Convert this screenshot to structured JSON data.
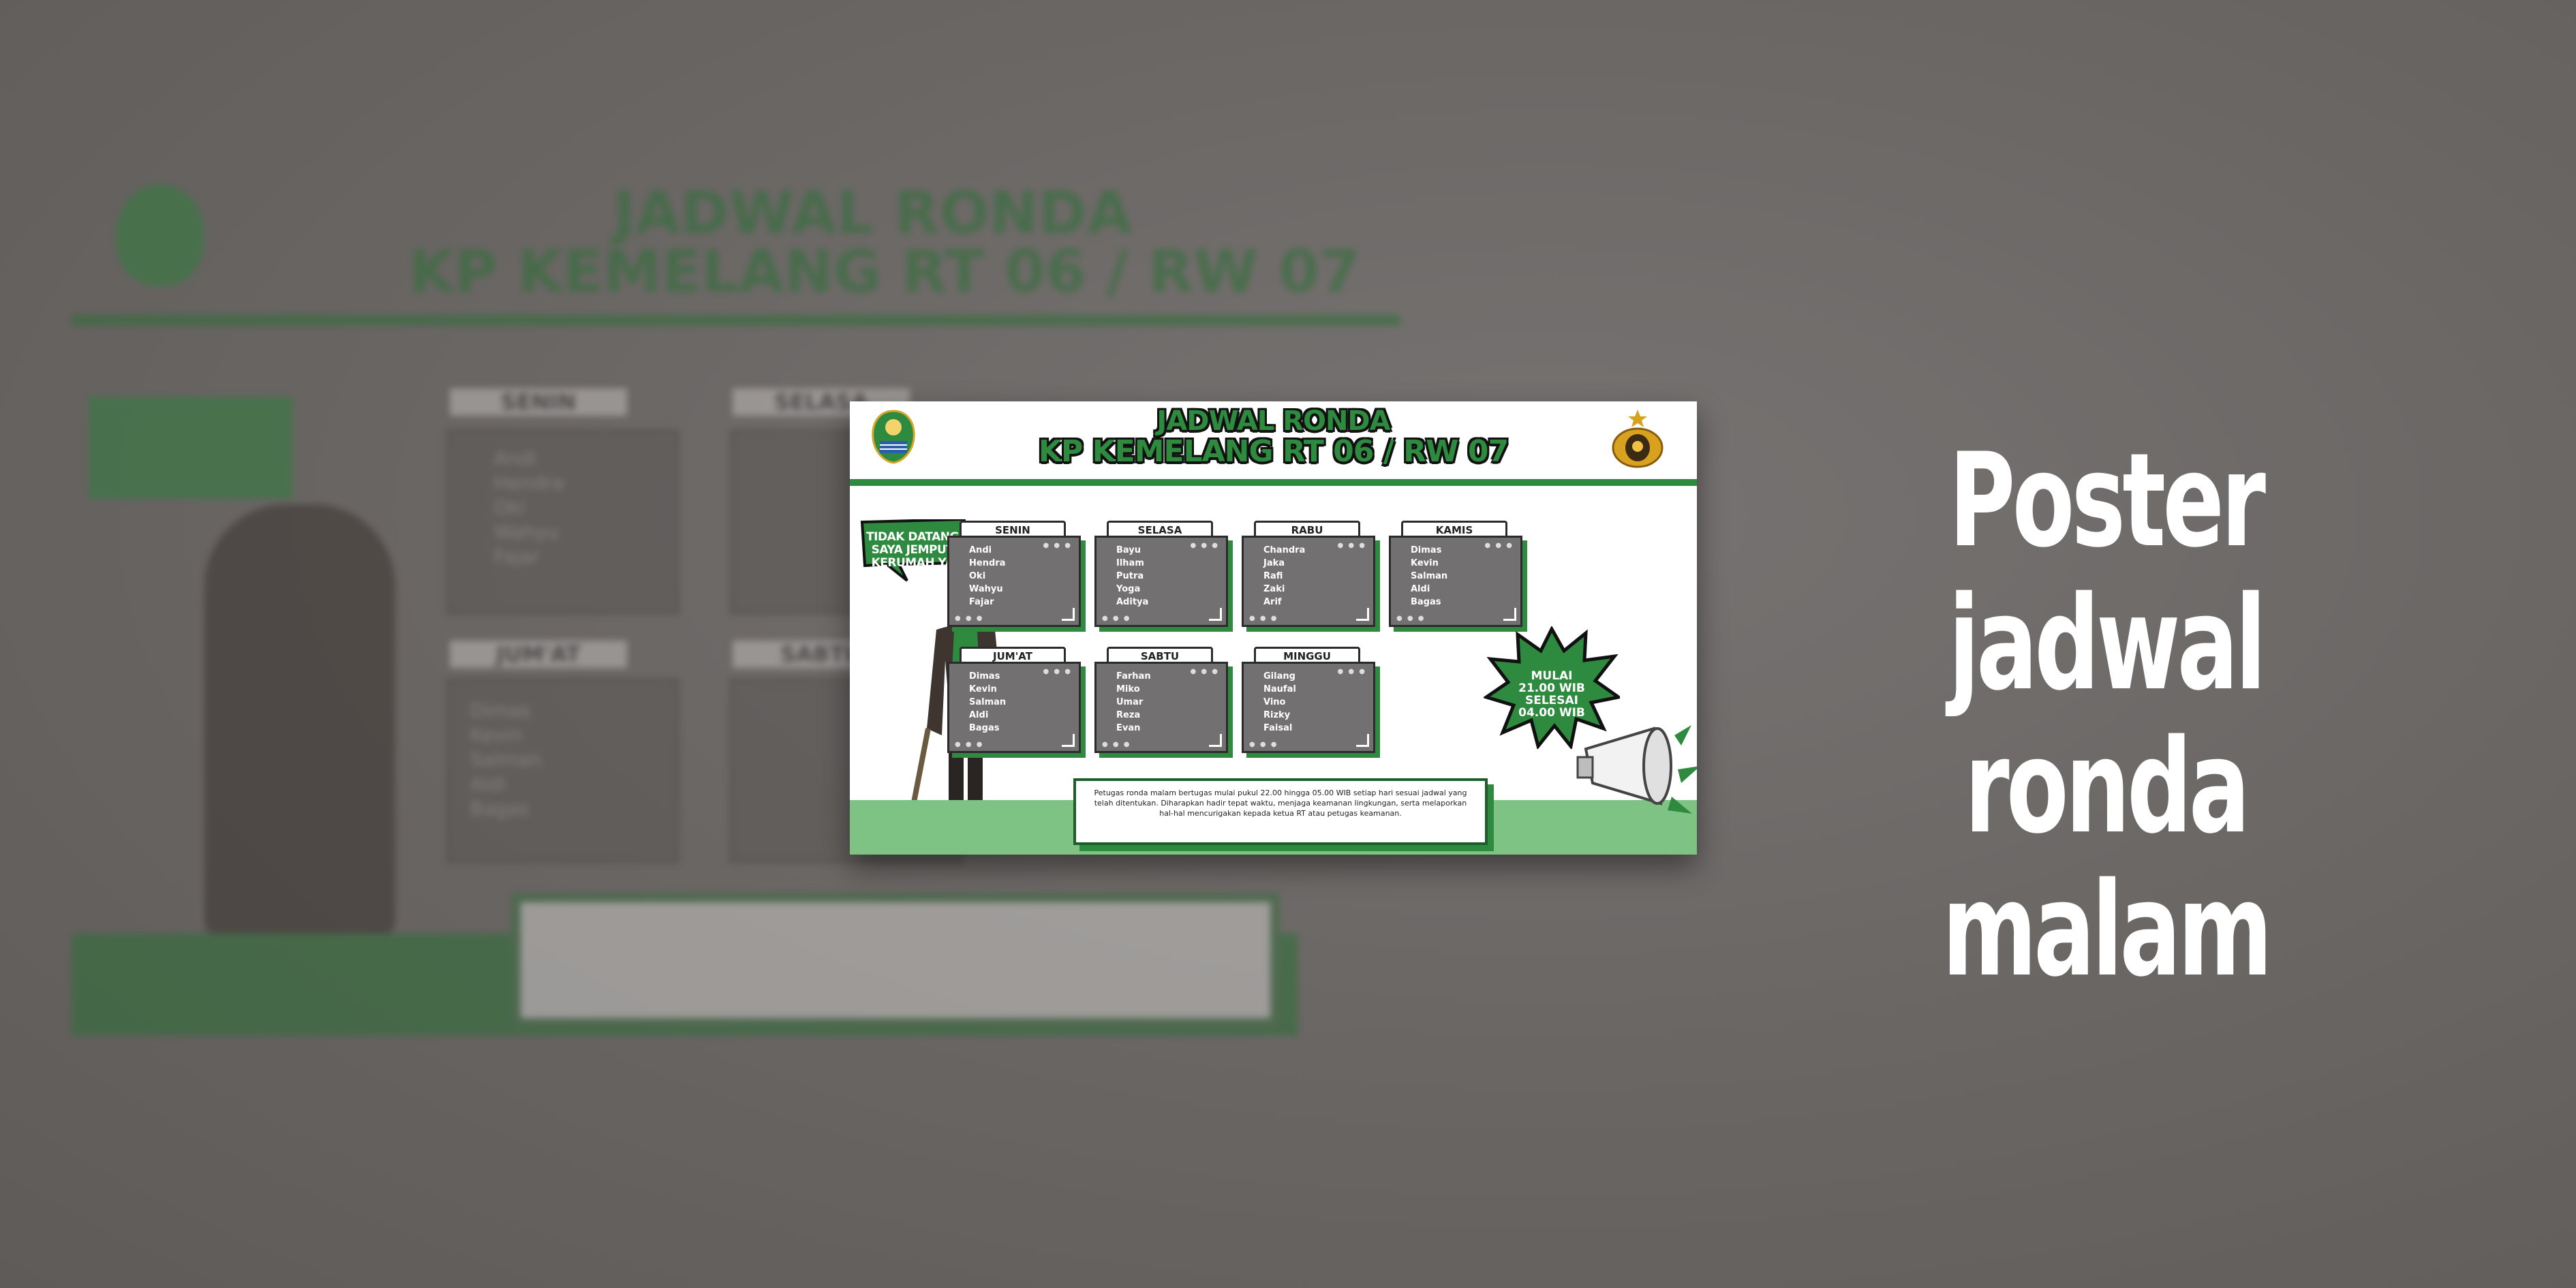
{
  "poster": {
    "title_line1": "JADWAL RONDA",
    "title_line2": "KP KEMELANG RT 06 / RW 07",
    "speech_bubble": [
      "TIDAK DATANG",
      "SAYA JEMPUT",
      "KERUMAH YA"
    ],
    "days": [
      {
        "name": "SENIN",
        "members": [
          "Andi",
          "Hendra",
          "Oki",
          "Wahyu",
          "Fajar"
        ]
      },
      {
        "name": "SELASA",
        "members": [
          "Bayu",
          "Ilham",
          "Putra",
          "Yoga",
          "Aditya"
        ]
      },
      {
        "name": "RABU",
        "members": [
          "Chandra",
          "Jaka",
          "Rafi",
          "Zaki",
          "Arif"
        ]
      },
      {
        "name": "KAMIS",
        "members": [
          "Dimas",
          "Kevin",
          "Salman",
          "Aldi",
          "Bagas"
        ]
      },
      {
        "name": "JUM'AT",
        "members": [
          "Dimas",
          "Kevin",
          "Salman",
          "Aldi",
          "Bagas"
        ]
      },
      {
        "name": "SABTU",
        "members": [
          "Farhan",
          "Miko",
          "Umar",
          "Reza",
          "Evan"
        ]
      },
      {
        "name": "MINGGU",
        "members": [
          "Gilang",
          "Naufal",
          "Vino",
          "Rizky",
          "Faisal"
        ]
      }
    ],
    "time_badge": [
      "MULAI",
      "21.00 WIB",
      "SELESAI",
      "04.00 WIB"
    ],
    "note": "Petugas ronda malam bertugas mulai pukul 22.00 hingga 05.00 WIB setiap hari sesuai jadwal yang telah ditentukan. Diharapkan hadir tepat waktu, menjaga keamanan lingkungan, serta melaporkan hal-hal mencurigakan kepada ketua RT atau petugas keamanan."
  },
  "headline": [
    "Poster",
    "jadwal ronda",
    "malam"
  ],
  "colors": {
    "green": "#2d8a3e",
    "light_green": "#7ec383",
    "card_grey": "#727070",
    "background": "#6b6765"
  },
  "icons": [
    "west-java-emblem-icon",
    "police-emblem-icon",
    "megaphone-icon",
    "speech-bubble-icon"
  ]
}
